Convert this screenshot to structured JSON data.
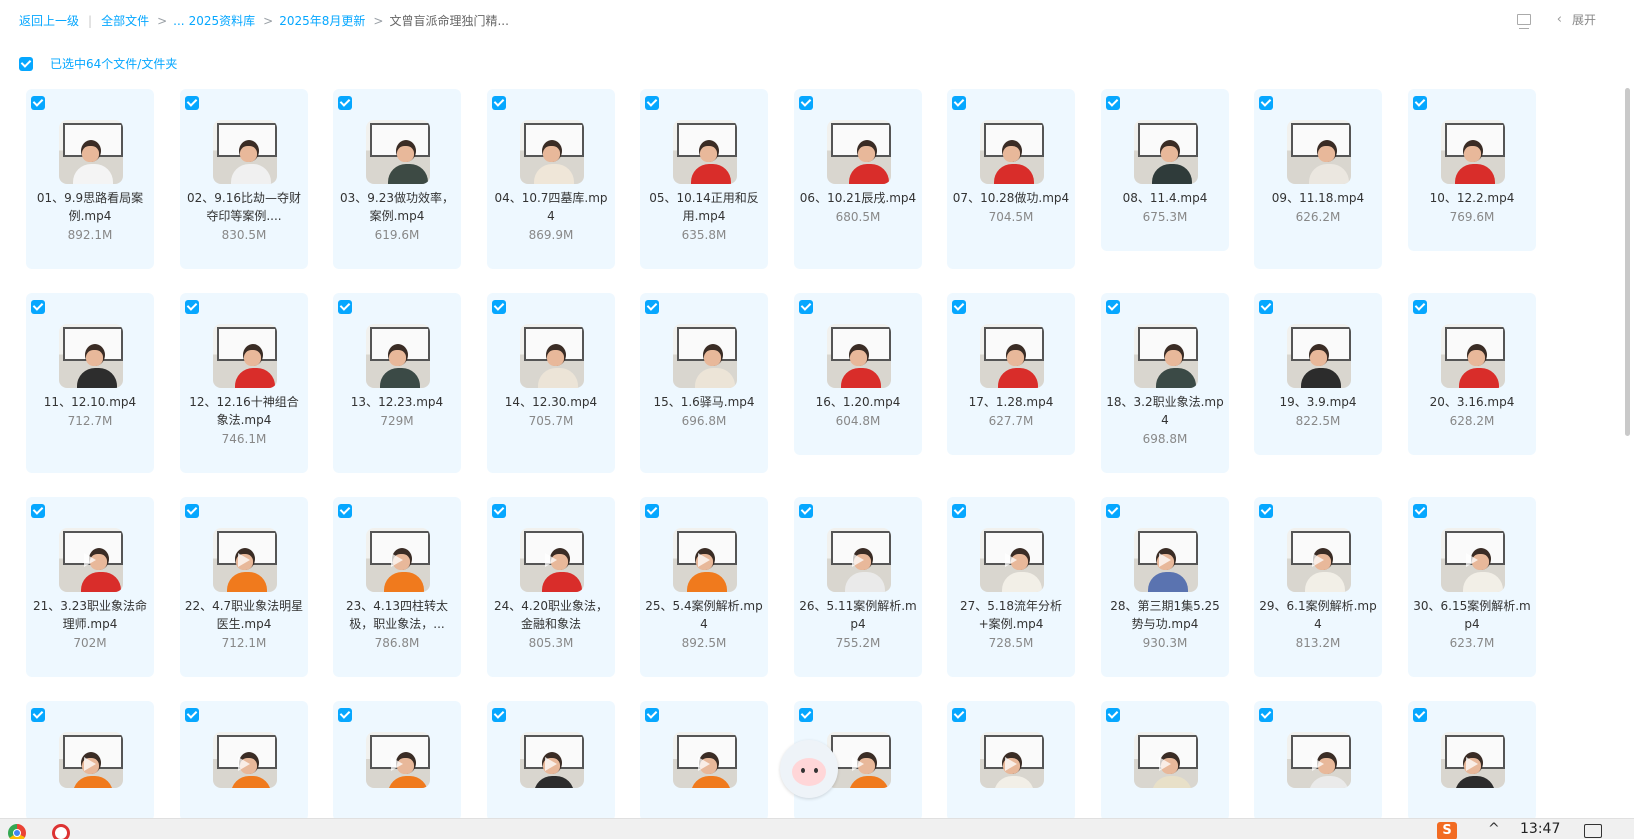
{
  "breadcrumb": {
    "back": "返回上一级",
    "all_files": "全部文件",
    "ellipsis": "...",
    "lib": "2025资料库",
    "aug": "2025年8月更新",
    "current": "文曾盲派命理独门精..."
  },
  "top_right": {
    "expand": "展开"
  },
  "selection": {
    "label": "已选中64个文件/文件夹"
  },
  "files": [
    {
      "name": "01、9.9思路看局案例.mp4",
      "size": "892.1M"
    },
    {
      "name": "02、9.16比劫—夺财夺印等案例....",
      "size": "830.5M"
    },
    {
      "name": "03、9.23做功效率，案例.mp4",
      "size": "619.6M"
    },
    {
      "name": "04、10.7四墓库.mp4",
      "size": "869.9M"
    },
    {
      "name": "05、10.14正用和反用.mp4",
      "size": "635.8M"
    },
    {
      "name": "06、10.21辰戌.mp4",
      "size": "680.5M"
    },
    {
      "name": "07、10.28做功.mp4",
      "size": "704.5M"
    },
    {
      "name": "08、11.4.mp4",
      "size": "675.3M"
    },
    {
      "name": "09、11.18.mp4",
      "size": "626.2M"
    },
    {
      "name": "10、12.2.mp4",
      "size": "769.6M"
    },
    {
      "name": "11、12.10.mp4",
      "size": "712.7M"
    },
    {
      "name": "12、12.16十神组合象法.mp4",
      "size": "746.1M"
    },
    {
      "name": "13、12.23.mp4",
      "size": "729M"
    },
    {
      "name": "14、12.30.mp4",
      "size": "705.7M"
    },
    {
      "name": "15、1.6驿马.mp4",
      "size": "696.8M"
    },
    {
      "name": "16、1.20.mp4",
      "size": "604.8M"
    },
    {
      "name": "17、1.28.mp4",
      "size": "627.7M"
    },
    {
      "name": "18、3.2职业象法.mp4",
      "size": "698.8M"
    },
    {
      "name": "19、3.9.mp4",
      "size": "822.5M"
    },
    {
      "name": "20、3.16.mp4",
      "size": "628.2M"
    },
    {
      "name": "21、3.23职业象法命理师.mp4",
      "size": "702M"
    },
    {
      "name": "22、4.7职业象法明星医生.mp4",
      "size": "712.1M"
    },
    {
      "name": "23、4.13四柱转太极，职业象法，...",
      "size": "786.8M"
    },
    {
      "name": "24、4.20职业象法，金融和象法",
      "size": "805.3M"
    },
    {
      "name": "25、5.4案例解析.mp4",
      "size": "892.5M"
    },
    {
      "name": "26、5.11案例解析.mp4",
      "size": "755.2M"
    },
    {
      "name": "27、5.18流年分析+案例.mp4",
      "size": "728.5M"
    },
    {
      "name": "28、第三期1集5.25势与功.mp4",
      "size": "930.3M"
    },
    {
      "name": "29、6.1案例解析.mp4",
      "size": "813.2M"
    },
    {
      "name": "30、6.15案例解析.mp4",
      "size": "623.7M"
    },
    {
      "name": "",
      "size": ""
    },
    {
      "name": "",
      "size": ""
    },
    {
      "name": "",
      "size": ""
    },
    {
      "name": "",
      "size": ""
    },
    {
      "name": "",
      "size": ""
    },
    {
      "name": "",
      "size": ""
    },
    {
      "name": "",
      "size": ""
    },
    {
      "name": "",
      "size": ""
    },
    {
      "name": "",
      "size": ""
    },
    {
      "name": "",
      "size": ""
    }
  ],
  "taskbar": {
    "ime": "S",
    "time": "13:47"
  }
}
